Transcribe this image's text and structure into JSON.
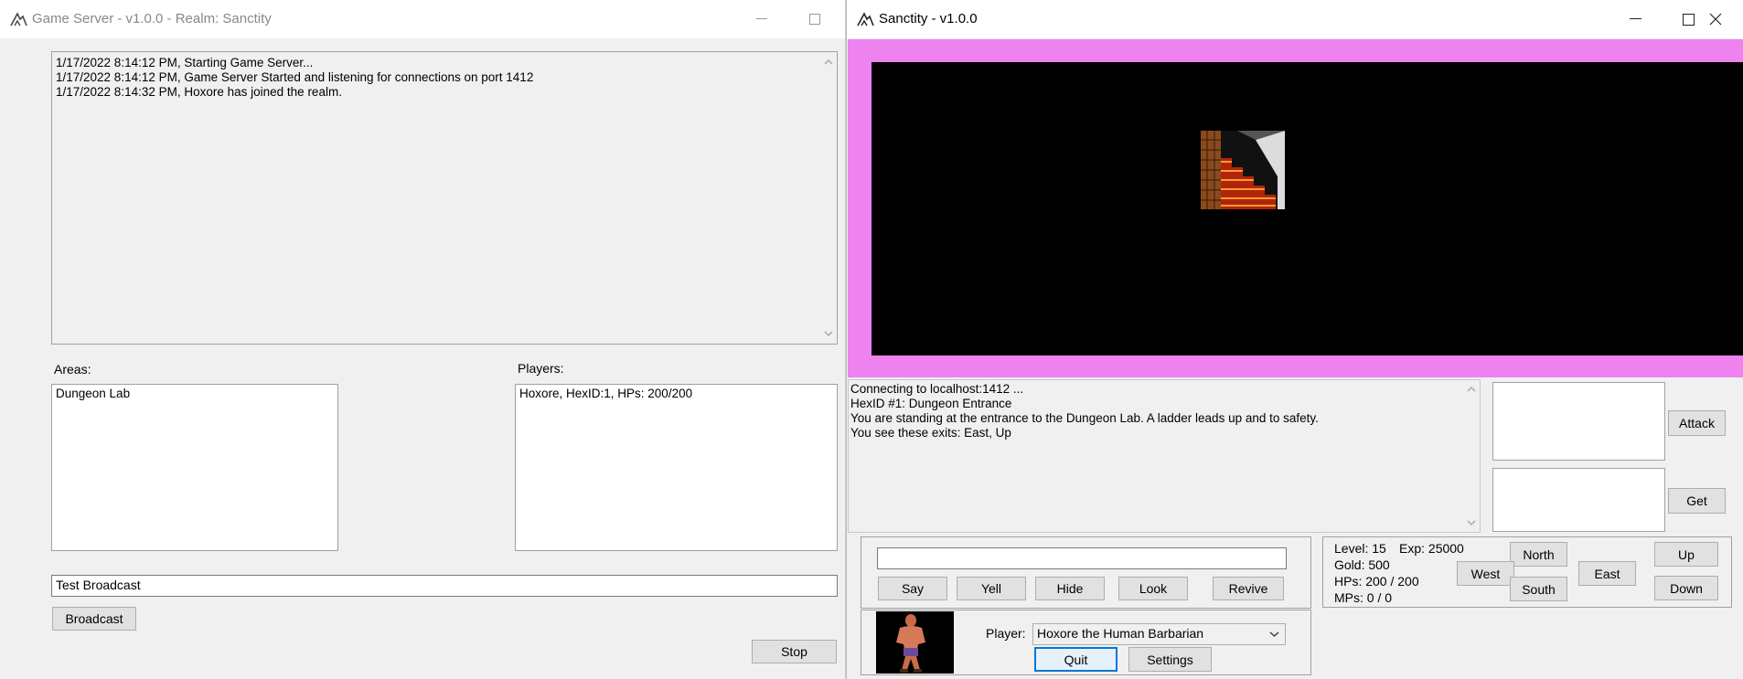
{
  "server_window": {
    "title": "Game Server - v1.0.0 - Realm: Sanctity",
    "log": [
      "1/17/2022 8:14:12 PM, Starting Game Server...",
      "1/17/2022 8:14:12 PM, Game Server Started and listening for connections on port 1412",
      "1/17/2022 8:14:32 PM, Hoxore has joined the realm."
    ],
    "areas_label": "Areas:",
    "areas": [
      "Dungeon Lab"
    ],
    "players_label": "Players:",
    "players": [
      "Hoxore, HexID:1, HPs: 200/200"
    ],
    "broadcast_value": "Test Broadcast",
    "broadcast_button": "Broadcast",
    "stop_button": "Stop"
  },
  "client_window": {
    "title": "Sanctity - v1.0.0",
    "log": [
      "Connecting to localhost:1412 ...",
      "HexID #1: Dungeon Entrance",
      "You are standing at the entrance to the Dungeon Lab. A ladder leads up and to safety.",
      "You see these exits:  East, Up"
    ],
    "actions": {
      "attack": "Attack",
      "get": "Get"
    },
    "command_input_value": "",
    "command_buttons": {
      "say": "Say",
      "yell": "Yell",
      "hide": "Hide",
      "look": "Look",
      "revive": "Revive"
    },
    "stats": {
      "level": "Level: 15",
      "exp": "Exp: 25000",
      "gold": "Gold: 500",
      "hps": "HPs: 200 / 200",
      "mps": "MPs: 0 / 0"
    },
    "directions": {
      "north": "North",
      "south": "South",
      "west": "West",
      "east": "East",
      "up": "Up",
      "down": "Down"
    },
    "player_label": "Player:",
    "player_selected": "Hoxore the Human Barbarian",
    "quit_button": "Quit",
    "settings_button": "Settings"
  },
  "colors": {
    "game_frame": "#ee82ee",
    "window_bg": "#f0f0f0",
    "default_button_border": "#0078d7"
  }
}
